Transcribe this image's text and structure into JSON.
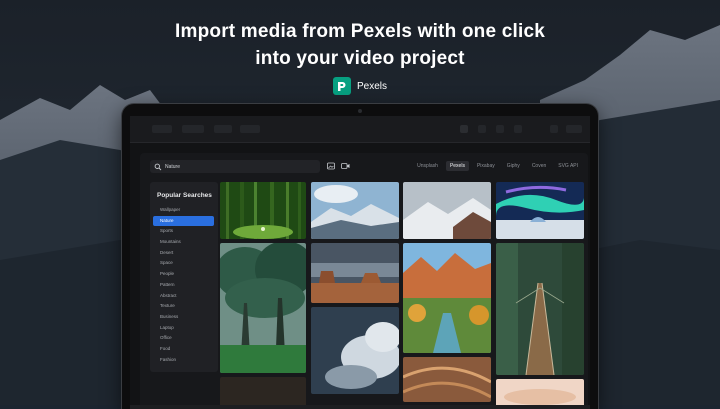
{
  "headline": {
    "line1": "Import media from Pexels with one click",
    "line2": "into your video project"
  },
  "brand": {
    "name": "Pexels",
    "logo_color": "#07a081",
    "logo_icon": "pexels-logo-icon"
  },
  "dialog": {
    "search": {
      "value": "Nature",
      "icon": "search-icon"
    },
    "filter_icons": [
      "image-icon",
      "video-icon"
    ],
    "sources": [
      "Unsplash",
      "Pexels",
      "Pixabay",
      "Giphy",
      "Coven",
      "SVG API"
    ],
    "active_source": "Pexels",
    "sidebar": {
      "title": "Popular Searches",
      "items": [
        "Wallpaper",
        "Nature",
        "Sports",
        "Mountains",
        "Desert",
        "Space",
        "People",
        "Pattern",
        "Abstract",
        "Texture",
        "Business",
        "Laptop",
        "Office",
        "Food",
        "Fashion"
      ],
      "active_item": "Nature"
    }
  },
  "colors": {
    "accent": "#2a6fe0",
    "background": "#121315"
  }
}
